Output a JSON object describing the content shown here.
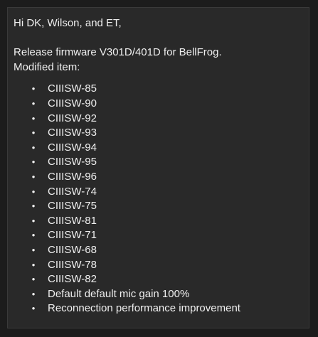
{
  "message": {
    "greeting": "Hi DK, Wilson, and ET,",
    "release_line": "Release firmware V301D/401D for BellFrog.",
    "modified_label": "Modified item:",
    "bullet_glyph": "•",
    "items": [
      "CIIISW-85",
      "CIIISW-90",
      "CIIISW-92",
      "CIIISW-93",
      "CIIISW-94",
      "CIIISW-95",
      "CIIISW-96",
      "CIIISW-74",
      "CIIISW-75",
      "CIIISW-81",
      "CIIISW-71",
      "CIIISW-68",
      "CIIISW-78",
      "CIIISW-82",
      "Default default mic gain 100%",
      "Reconnection performance improvement"
    ]
  },
  "colors": {
    "background": "#1c1c1c",
    "panel": "#292929",
    "text": "#efefef"
  }
}
